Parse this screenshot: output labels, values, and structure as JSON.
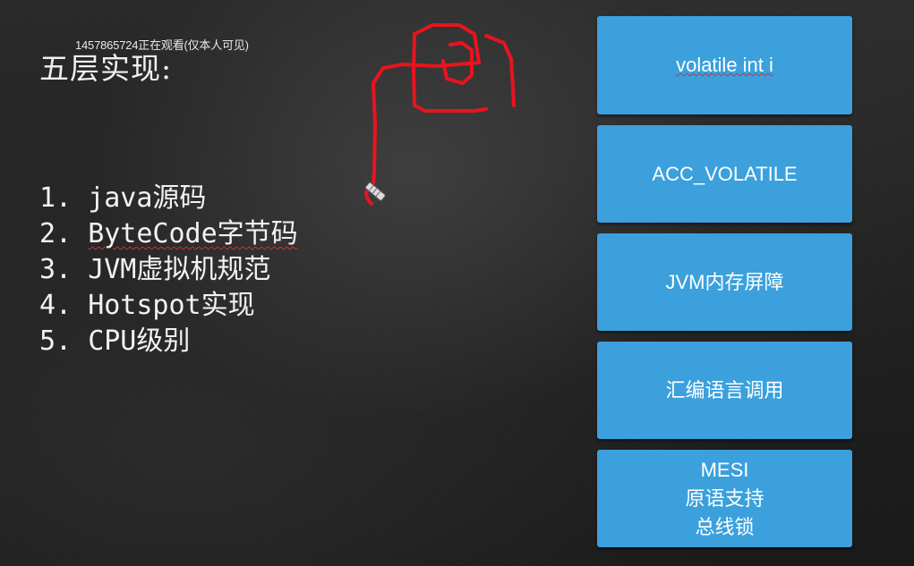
{
  "watermark": "1457865724正在观看(仅本人可见)",
  "slide": {
    "title": "五层实现:",
    "layers": [
      {
        "num": "1.",
        "text": "java源码"
      },
      {
        "num": "2.",
        "text": "ByteCode字节码"
      },
      {
        "num": "3.",
        "text": "JVM虚拟机规范"
      },
      {
        "num": "4.",
        "text": "Hotspot实现"
      },
      {
        "num": "5.",
        "text": "CPU级别"
      }
    ],
    "boxes": [
      {
        "line1": "volatile int i"
      },
      {
        "line1": "ACC_VOLATILE"
      },
      {
        "line1": "JVM内存屏障"
      },
      {
        "line1": "汇编语言调用"
      },
      {
        "line1": "MESI",
        "line2": "原语支持",
        "line3": "总线锁"
      }
    ]
  },
  "colors": {
    "box_fill": "#3ba0dc",
    "annotation_ink": "#e8141e",
    "board": "#222222"
  },
  "icons": {
    "cursor": "pen-cursor-icon"
  }
}
